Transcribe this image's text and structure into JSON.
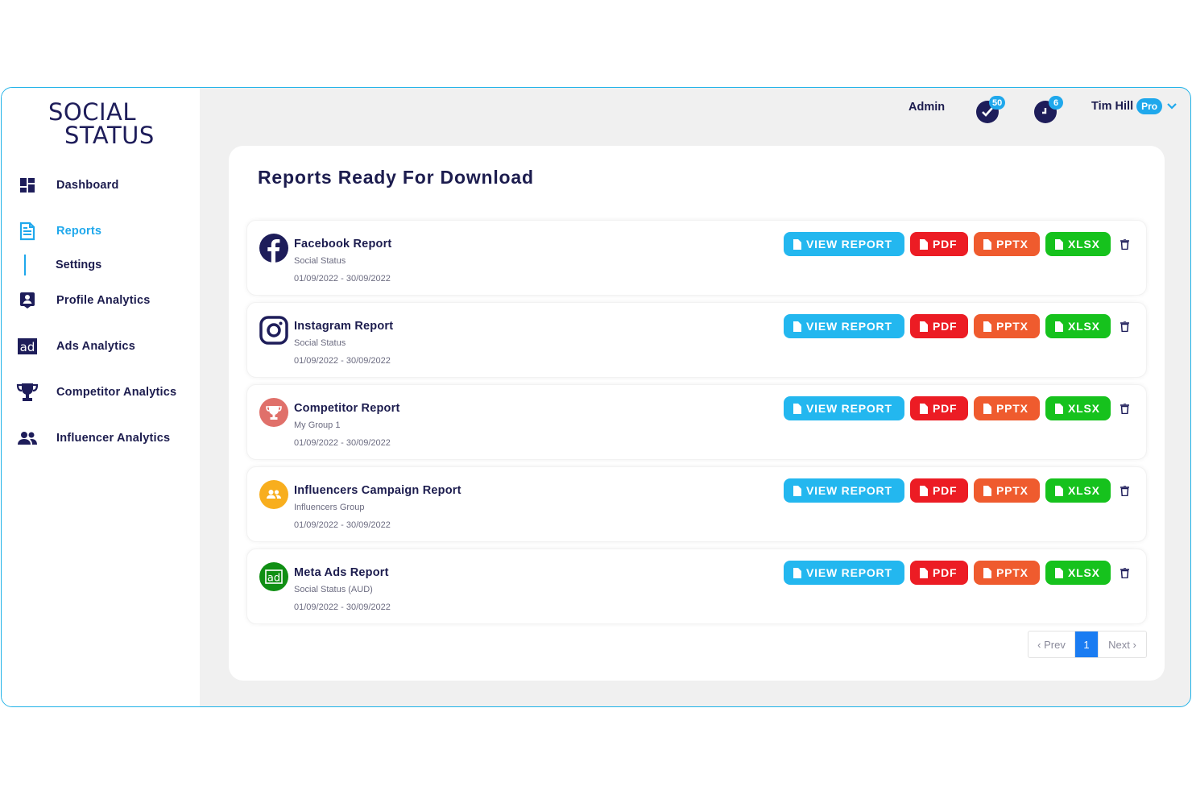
{
  "brand": {
    "line1": "SOCIAL",
    "line2": "STATUS"
  },
  "sidebar": {
    "items": [
      {
        "label": "Dashboard",
        "icon": "dashboard-icon"
      },
      {
        "label": "Reports",
        "icon": "reports-icon",
        "active": true
      },
      {
        "label": "Settings",
        "sub": true
      },
      {
        "label": "Profile Analytics",
        "icon": "profile-icon"
      },
      {
        "label": "Ads Analytics",
        "icon": "ad-icon"
      },
      {
        "label": "Competitor Analytics",
        "icon": "trophy-icon"
      },
      {
        "label": "Influencer Analytics",
        "icon": "people-icon"
      }
    ]
  },
  "topbar": {
    "admin": "Admin",
    "notif_tasks": "50",
    "notif_clock": "6",
    "user_name": "Tim Hill",
    "user_badge": "Pro"
  },
  "main": {
    "title": "Reports Ready For Download",
    "buttons": {
      "view": "VIEW REPORT",
      "pdf": "PDF",
      "pptx": "PPTX",
      "xlsx": "XLSX"
    },
    "reports": [
      {
        "title": "Facebook Report",
        "sub": "Social Status",
        "date": "01/09/2022 - 30/09/2022",
        "icon": "facebook-icon"
      },
      {
        "title": "Instagram Report",
        "sub": "Social Status",
        "date": "01/09/2022 - 30/09/2022",
        "icon": "instagram-icon"
      },
      {
        "title": "Competitor Report",
        "sub": "My Group 1",
        "date": "01/09/2022 - 30/09/2022",
        "icon": "trophy-icon"
      },
      {
        "title": "Influencers Campaign Report",
        "sub": "Influencers Group",
        "date": "01/09/2022 - 30/09/2022",
        "icon": "people-icon"
      },
      {
        "title": "Meta Ads Report",
        "sub": "Social Status (AUD)",
        "date": "01/09/2022 - 30/09/2022",
        "icon": "ad-icon"
      }
    ],
    "pager": {
      "prev": "‹ Prev",
      "current": "1",
      "next": "Next ›"
    }
  },
  "colors": {
    "brand_navy": "#1e1d5a",
    "accent": "#1fa8ec",
    "view": "#23b7ef",
    "pdf": "#ec1c24",
    "pptx": "#ef5b2e",
    "xlsx": "#16c21d"
  }
}
